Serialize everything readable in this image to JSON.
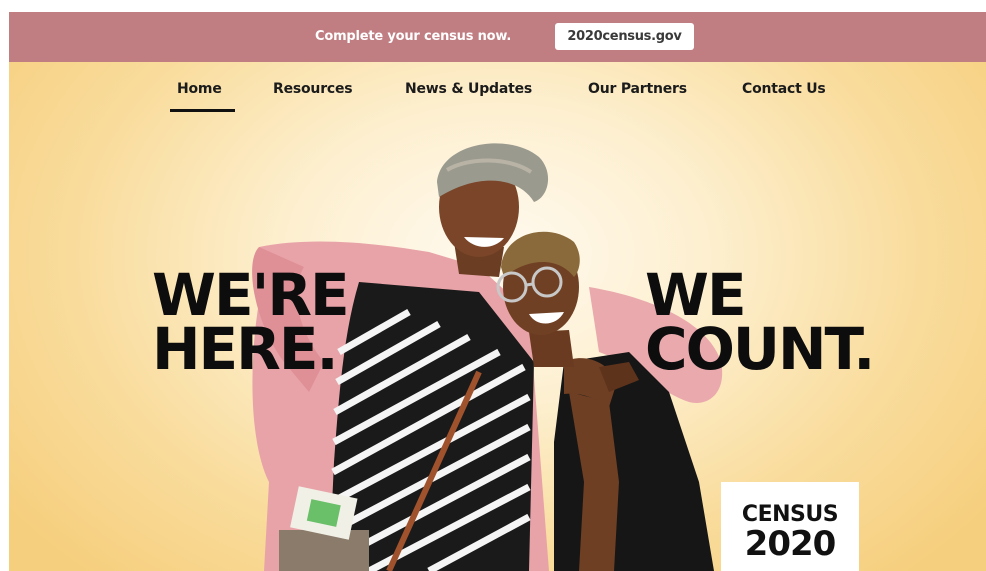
{
  "banner": {
    "message": "Complete your census now.",
    "cta_label": "2020census.gov"
  },
  "nav": {
    "items": [
      {
        "label": "Home",
        "active": true
      },
      {
        "label": "Resources",
        "active": false
      },
      {
        "label": "News & Updates",
        "active": false
      },
      {
        "label": "Our Partners",
        "active": false
      },
      {
        "label": "Contact Us",
        "active": false
      }
    ]
  },
  "hero": {
    "headline_left": [
      "WE'RE",
      "HERE."
    ],
    "headline_right": [
      "WE",
      "COUNT."
    ]
  },
  "logo": {
    "word": "CENSUS",
    "year": "2020"
  },
  "colors": {
    "banner": "#c07d82",
    "background_gold": "#f6cf7e",
    "text_dark": "#0d0d0d"
  }
}
